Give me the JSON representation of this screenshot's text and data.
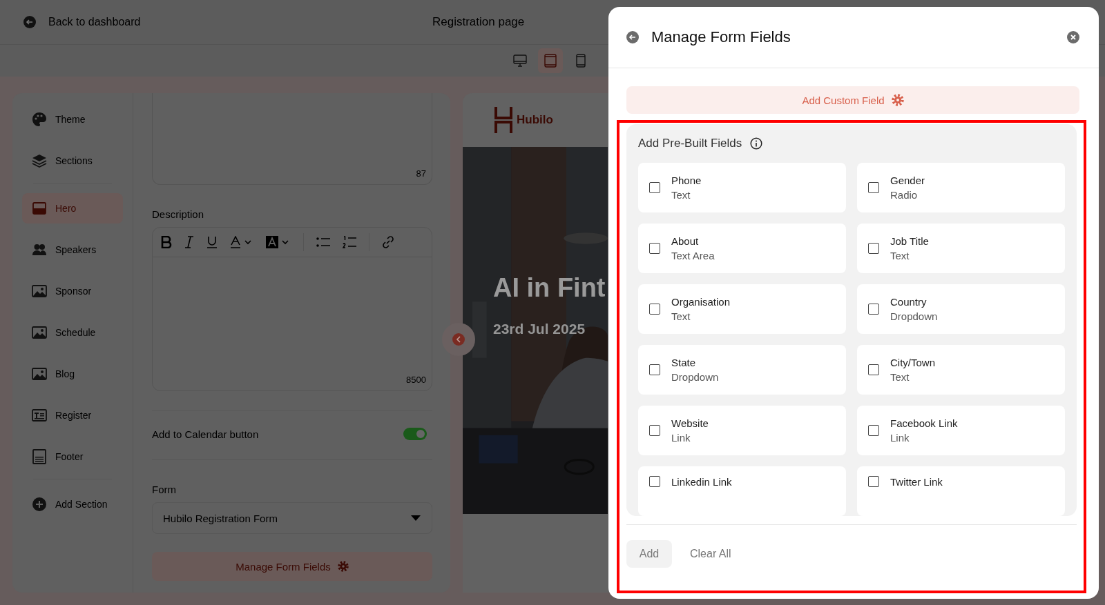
{
  "header": {
    "back_label": "Back to dashboard",
    "title": "Registration page"
  },
  "device_toggle": [
    {
      "selected": false
    },
    {
      "selected": true
    },
    {
      "selected": false
    }
  ],
  "sidebar": {
    "groups": [
      [
        {
          "label": "Theme",
          "selected": false
        },
        {
          "label": "Sections",
          "selected": false
        }
      ],
      [
        {
          "label": "Hero",
          "selected": true
        },
        {
          "label": "Speakers",
          "selected": false
        },
        {
          "label": "Sponsor",
          "selected": false
        },
        {
          "label": "Schedule",
          "selected": false
        },
        {
          "label": "Blog",
          "selected": false
        },
        {
          "label": "Register",
          "selected": false
        },
        {
          "label": "Footer",
          "selected": false
        }
      ],
      [
        {
          "label": "Add Section",
          "selected": false
        }
      ]
    ]
  },
  "editor": {
    "title_counter": "87",
    "description_label": "Description",
    "description_counter": "8500",
    "calendar_toggle": {
      "label": "Add to Calendar button",
      "on": true
    },
    "form": {
      "label": "Form",
      "value": "Hubilo Registration Form"
    },
    "manage_button": "Manage Form Fields"
  },
  "preview": {
    "logo": "Hubilo",
    "hero_title": "AI in Fint",
    "hero_date": "23rd Jul 2025"
  },
  "drawer": {
    "title": "Manage Form Fields",
    "custom_button": "Add Custom Field",
    "prebuilt": {
      "title": "Add Pre-Built Fields",
      "fields": [
        {
          "name": "Phone",
          "type": "Text",
          "checked": false
        },
        {
          "name": "Gender",
          "type": "Radio",
          "checked": false
        },
        {
          "name": "About",
          "type": "Text Area",
          "checked": false
        },
        {
          "name": "Job Title",
          "type": "Text",
          "checked": false
        },
        {
          "name": "Organisation",
          "type": "Text",
          "checked": false
        },
        {
          "name": "Country",
          "type": "Dropdown",
          "checked": false
        },
        {
          "name": "State",
          "type": "Dropdown",
          "checked": false
        },
        {
          "name": "City/Town",
          "type": "Text",
          "checked": false
        },
        {
          "name": "Website",
          "type": "Link",
          "checked": false
        },
        {
          "name": "Facebook Link",
          "type": "Link",
          "checked": false
        },
        {
          "name": "Linkedin Link",
          "checked": false
        },
        {
          "name": "Twitter Link",
          "checked": false
        }
      ]
    },
    "add_button": {
      "label": "Add",
      "disabled": true
    },
    "clear_button": "Clear All"
  }
}
